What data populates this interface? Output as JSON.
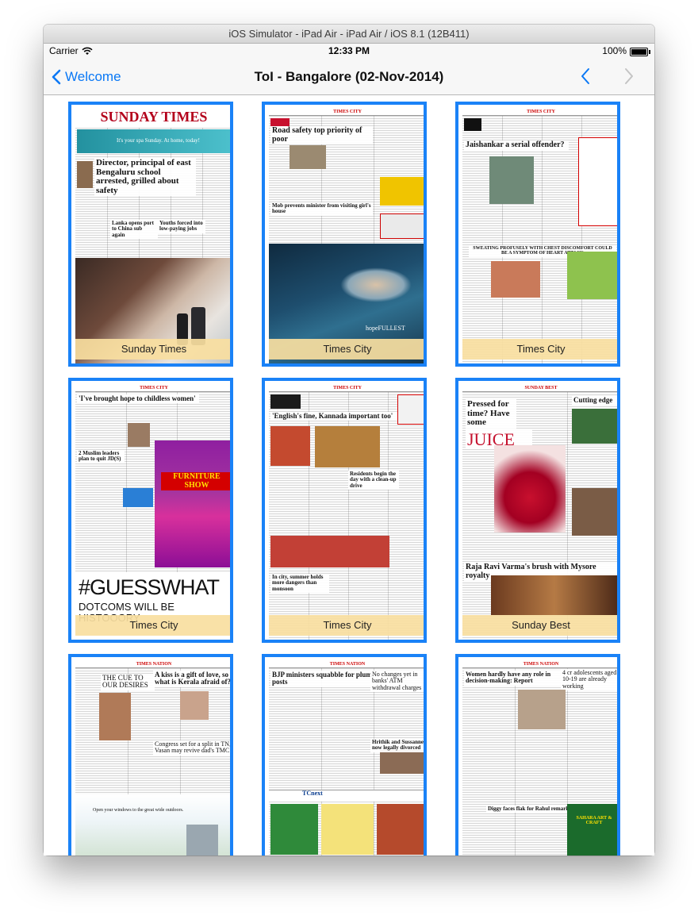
{
  "window": {
    "title": "iOS Simulator - iPad Air - iPad Air / iOS 8.1 (12B411)"
  },
  "status_bar": {
    "carrier": "Carrier",
    "time": "12:33 PM",
    "battery": "100%"
  },
  "nav": {
    "back_label": "Welcome",
    "title": "ToI - Bangalore (02-Nov-2014)"
  },
  "pages": [
    {
      "caption": "Sunday Times",
      "masthead": "SUNDAY TIMES",
      "banner": "It's your spa Sunday. At home, today!",
      "headlines": [
        "Director, principal of east Bengaluru school arrested, grilled about safety",
        "Lanka opens port to China sub again",
        "Youths forced into low-paying jobs"
      ]
    },
    {
      "caption": "Times City",
      "masthead": "TIMES CITY",
      "headlines": [
        "Road safety top priority of poor",
        "Mob prevents minister from visiting girl's house"
      ],
      "ad_text": "hopeFULLEST"
    },
    {
      "caption": "Times City",
      "masthead": "TIMES CITY",
      "headlines": [
        "Jaishankar a serial offender?",
        "SWEATING PROFUSELY WITH CHEST DISCOMFORT COULD BE A SYMPTOM OF HEART ATTACK"
      ]
    },
    {
      "caption": "Times City",
      "masthead": "TIMES CITY",
      "headlines": [
        "'I've brought hope to childless women'",
        "2 Muslim leaders plan to quit JD(S)"
      ],
      "ad_title": "FURNITURE SHOW",
      "ad_bottom": "#GUESSWHAT",
      "ad_bottom2": "DOTCOMS WILL BE HISTOOORY"
    },
    {
      "caption": "Times City",
      "masthead": "TIMES CITY",
      "headlines": [
        "'English's fine, Kannada important too'",
        "Residents begin the day with a clean-up drive",
        "In city, summer holds more dangers than monsoon"
      ]
    },
    {
      "caption": "Sunday Best",
      "masthead": "SUNDAY BEST",
      "headlines": [
        "Pressed for time? Have some",
        "JUICE",
        "Cutting edge",
        "Raja Ravi Varma's brush with Mysore royalty"
      ]
    },
    {
      "caption": "",
      "masthead": "TIMES NATION",
      "headlines": [
        "A kiss is a gift of love, so what is Kerala afraid of?",
        "THE CUE TO OUR DESIRES",
        "Congress set for a split in TN, Vasan may revive dad's TMC",
        "Open your windows to the great wide outdoors."
      ]
    },
    {
      "caption": "",
      "masthead": "TIMES NATION",
      "headlines": [
        "BJP ministers squabble for plum posts",
        "No changes yet in banks' ATM withdrawal charges",
        "Hrithik and Sussanne now legally divorced",
        "TCnext"
      ]
    },
    {
      "caption": "",
      "masthead": "TIMES NATION",
      "headlines": [
        "Women hardly have any role in decision-making: Report",
        "4 cr adolescents aged 10-19 are already working",
        "Diggy faces flak for Rahul remark",
        "SAHARA ART & CRAFT"
      ]
    }
  ]
}
